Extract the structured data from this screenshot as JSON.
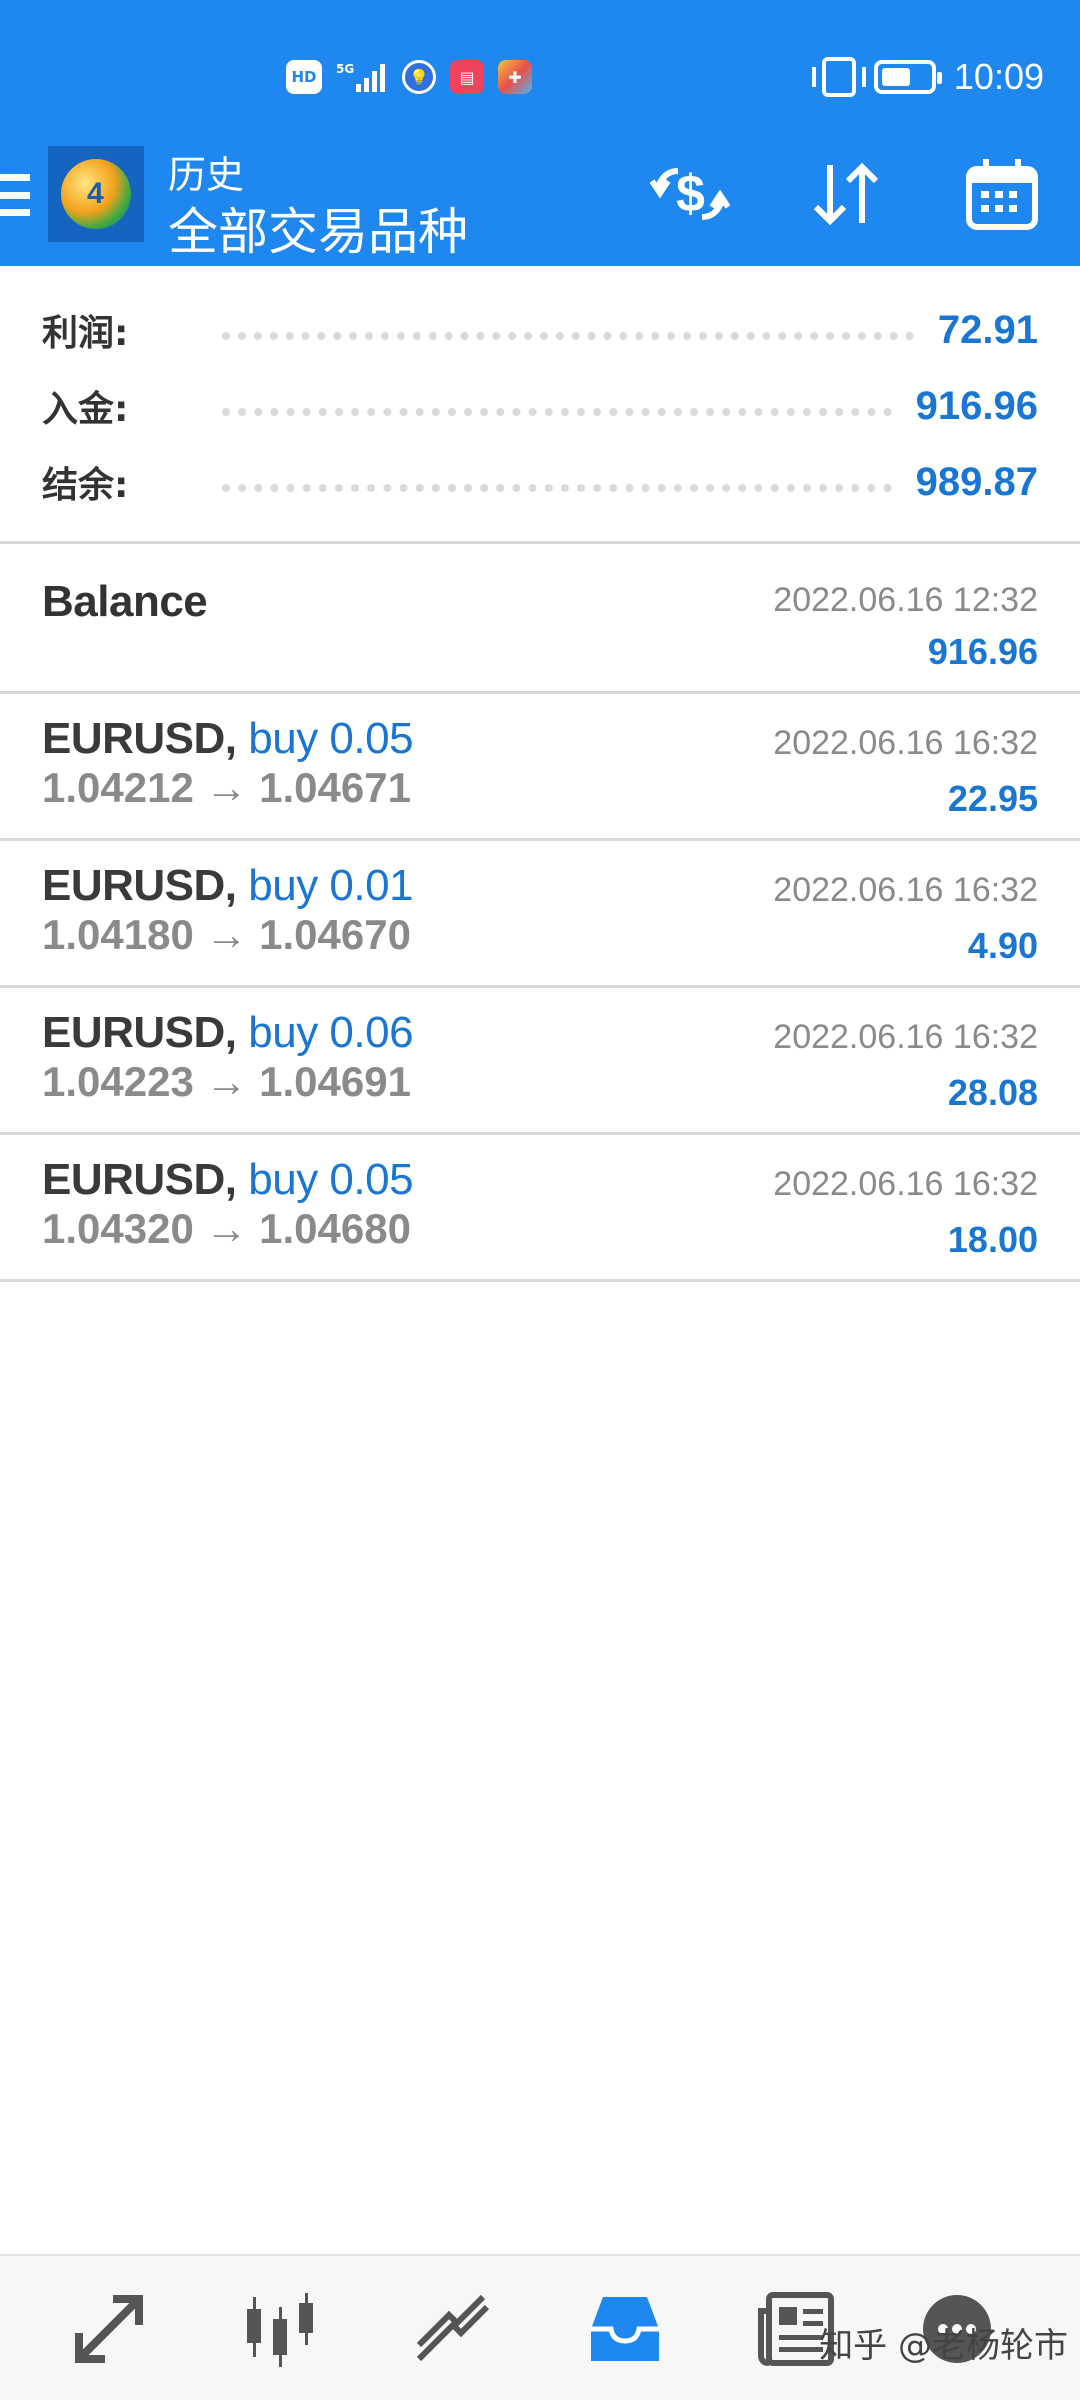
{
  "status_bar": {
    "icons": [
      "hd-icon",
      "5g-signal-icon",
      "bulb-app-icon",
      "book-app-icon",
      "color-app-icon"
    ],
    "hd_label": "HD",
    "net_label": "5G",
    "time": "10:09"
  },
  "app_bar": {
    "title_small": "历史",
    "title_big": "全部交易品种",
    "icons": [
      "menu-icon",
      "app-logo",
      "exchange-currency-icon",
      "sort-icon",
      "calendar-icon"
    ]
  },
  "summary": {
    "rows": [
      {
        "label": "利润:",
        "value": "72.91"
      },
      {
        "label": "入金:",
        "value": "916.96"
      },
      {
        "label": "结余:",
        "value": "989.87"
      }
    ]
  },
  "balance_entry": {
    "title": "Balance",
    "time": "2022.06.16 12:32",
    "amount": "916.96"
  },
  "deals": [
    {
      "symbol": "EURUSD,",
      "side": "buy 0.05",
      "prices": "1.04212 → 1.04671",
      "time": "2022.06.16 16:32",
      "profit": "22.95"
    },
    {
      "symbol": "EURUSD,",
      "side": "buy 0.01",
      "prices": "1.04180 → 1.04670",
      "time": "2022.06.16 16:32",
      "profit": "4.90"
    },
    {
      "symbol": "EURUSD,",
      "side": "buy 0.06",
      "prices": "1.04223 → 1.04691",
      "time": "2022.06.16 16:32",
      "profit": "28.08"
    },
    {
      "symbol": "EURUSD,",
      "side": "buy 0.05",
      "prices": "1.04320 → 1.04680",
      "time": "2022.06.16 16:32",
      "profit": "18.00"
    }
  ],
  "bottom_nav": {
    "items": [
      "quotes-icon",
      "chart-icon",
      "trade-icon",
      "history-icon",
      "news-icon",
      "messages-icon"
    ],
    "active": "history-icon",
    "watermark": "知乎 @老杨轮市"
  },
  "colors": {
    "primary": "#1e88f0",
    "value_blue": "#1976d2",
    "text_dark": "#333333",
    "text_grey": "#8a8a8a",
    "divider": "#d9d9d9"
  }
}
